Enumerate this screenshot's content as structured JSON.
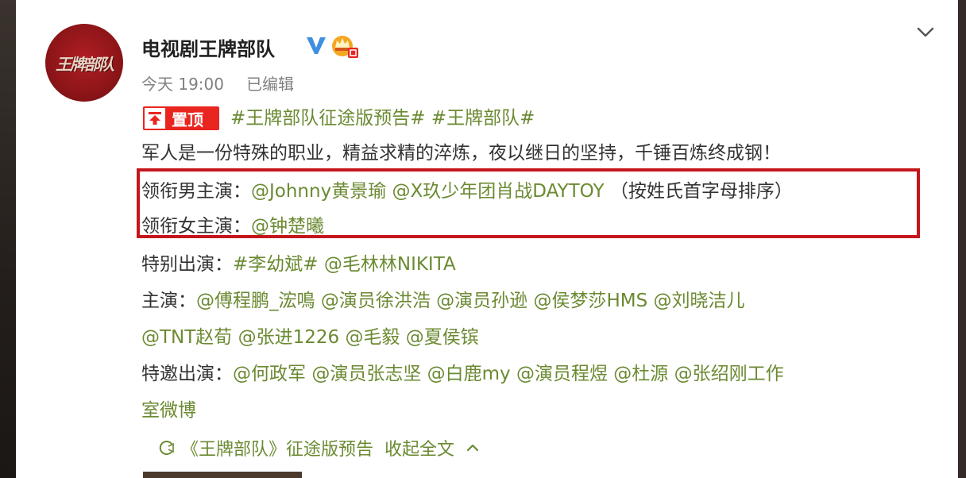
{
  "colors": {
    "link": "#6b8a32",
    "text": "#333333",
    "muted": "#808080",
    "pin": "#e8251f",
    "highlight": "#c4161c"
  },
  "post": {
    "avatar_text": "王牌部队",
    "account_name": "电视剧王牌部队",
    "timestamp": "今天 19:00",
    "edited": "已编辑",
    "pin_label": "置顶",
    "topics": [
      "#王牌部队征途版预告#",
      "#王牌部队#"
    ],
    "body": "军人是一份特殊的职业，精益求精的淬炼，夜以继日的坚持，千锤百炼终成钢！",
    "male_lead_label": "领衔男主演：",
    "male_leads": [
      "@Johnny黄景瑜",
      "@X玖少年团肖战DAYTOY"
    ],
    "male_lead_note": "（按姓氏首字母排序）",
    "female_lead_label": "领衔女主演：",
    "female_leads": [
      "@钟楚曦"
    ],
    "special_label": "特别出演：",
    "special": [
      "#李幼斌#",
      "@毛林林NIKITA"
    ],
    "cast_label": "主演：",
    "cast_line1": [
      "@傅程鹏_浤鳴",
      "@演员徐洪浩",
      "@演员孙逊",
      "@侯梦莎HMS",
      "@刘晓洁儿"
    ],
    "cast_line2": [
      "@TNT赵荀",
      "@张进1226",
      "@毛毅",
      "@夏侯镔"
    ],
    "guest_label": "特邀出演：",
    "guest_line1": [
      "@何政军",
      "@演员张志坚",
      "@白鹿my",
      "@演员程煜",
      "@杜源",
      "@张绍刚工作"
    ],
    "guest_line2": "室微博",
    "video_title": "《王牌部队》征途版预告",
    "collapse_label": "收起全文"
  },
  "icons": {
    "verified": "verified-v-icon",
    "crown": "crown-badge-icon",
    "menu": "chevron-down-icon",
    "pin": "pin-arrow-icon",
    "video": "video-icon",
    "collapse": "chevron-up-icon"
  }
}
